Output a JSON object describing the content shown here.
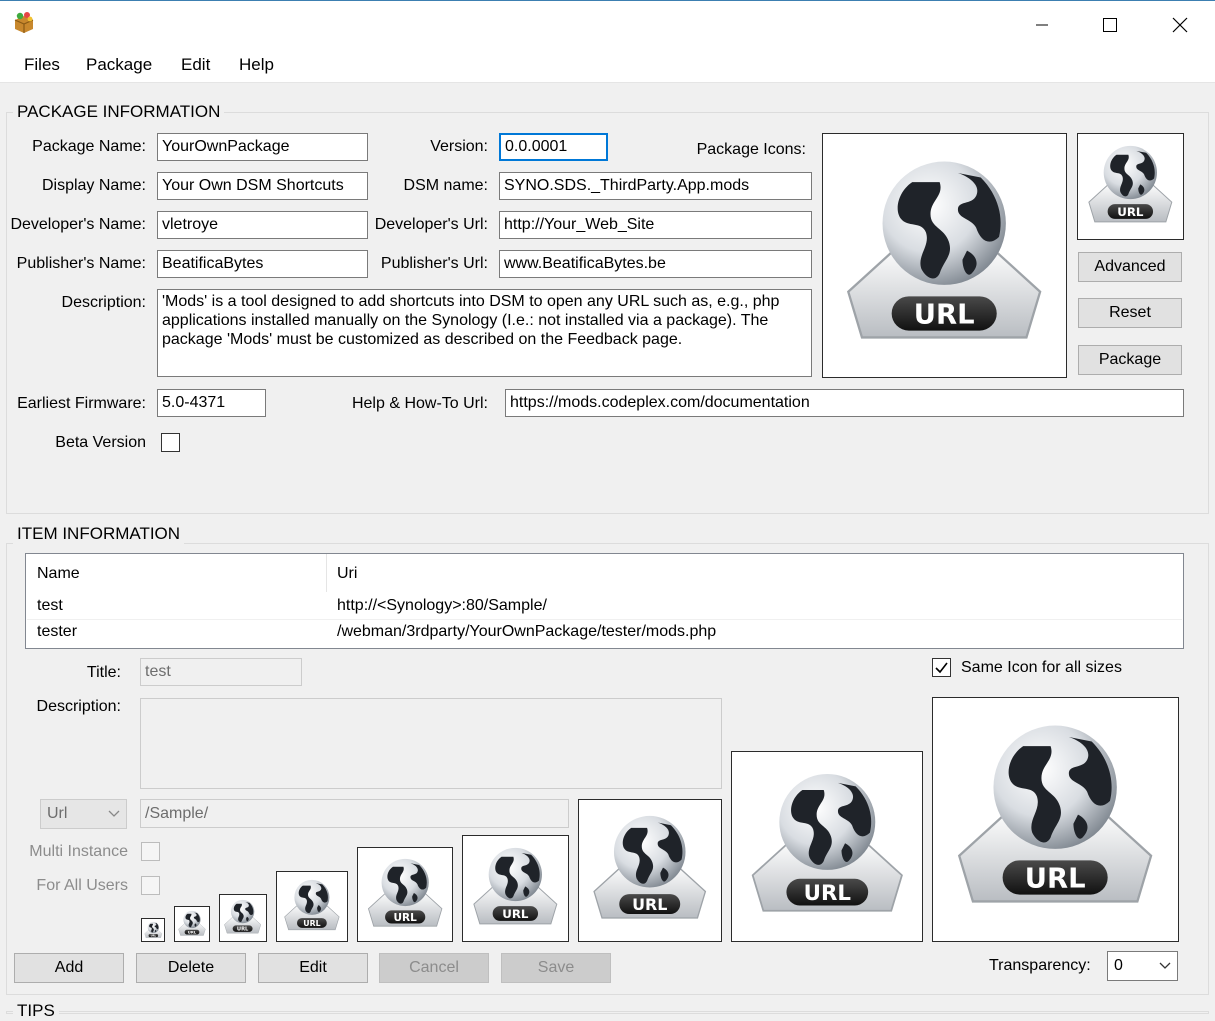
{
  "menu": [
    "Files",
    "Package",
    "Edit",
    "Help"
  ],
  "package_info": {
    "section_title": "PACKAGE INFORMATION",
    "package_name_label": "Package Name:",
    "package_name_value": "YourOwnPackage",
    "version_label": "Version:",
    "version_value": "0.0.0001",
    "package_icons_label": "Package Icons:",
    "display_name_label": "Display Name:",
    "display_name_value": "Your Own DSM Shortcuts",
    "dsm_name_label": "DSM name:",
    "dsm_name_value": "SYNO.SDS._ThirdParty.App.mods",
    "developer_name_label": "Developer's Name:",
    "developer_name_value": "vletroye",
    "developer_url_label": "Developer's Url:",
    "developer_url_value": "http://Your_Web_Site",
    "publisher_name_label": "Publisher's Name:",
    "publisher_name_value": "BeatificaBytes",
    "publisher_url_label": "Publisher's Url:",
    "publisher_url_value": "www.BeatificaBytes.be",
    "description_label": "Description:",
    "description_value": "'Mods' is a tool designed to add shortcuts into DSM to open any URL such as, e.g., php applications installed manually on the Synology (I.e.: not installed via a package). The package 'Mods' must be customized as described on the Feedback page.",
    "earliest_firmware_label": "Earliest Firmware:",
    "earliest_firmware_value": "5.0-4371",
    "help_url_label": "Help & How-To Url:",
    "help_url_value": "https://mods.codeplex.com/documentation",
    "beta_label": "Beta Version",
    "beta_checked": false,
    "advanced_button": "Advanced",
    "reset_button": "Reset",
    "package_button": "Package",
    "icon_text": "URL"
  },
  "item_info": {
    "section_title": "ITEM INFORMATION",
    "columns": [
      "Name",
      "Uri"
    ],
    "rows": [
      {
        "name": "test",
        "uri": "http://<Synology>:80/Sample/"
      },
      {
        "name": "tester",
        "uri": "/webman/3rdparty/YourOwnPackage/tester/mods.php"
      }
    ],
    "title_label": "Title:",
    "title_value": "test",
    "description_label": "Description:",
    "description_value": "",
    "type_select_value": "Url",
    "url_value": "/Sample/",
    "multi_instance_label": "Multi Instance",
    "for_all_users_label": "For All Users",
    "same_icon_label": "Same Icon for all sizes",
    "same_icon_checked": true,
    "transparency_label": "Transparency:",
    "transparency_value": "0",
    "add_button": "Add",
    "delete_button": "Delete",
    "edit_button": "Edit",
    "cancel_button": "Cancel",
    "save_button": "Save"
  },
  "tips": {
    "section_title": "TIPS"
  },
  "colors": {
    "window_bg": "#f0f0f0",
    "focus_border": "#0078d7",
    "title_border": "#3c7fb1"
  },
  "icons": [
    "package-box-icon",
    "minimize-icon",
    "maximize-icon",
    "close-icon",
    "globe-url-icon",
    "chevron-down-icon",
    "check-icon"
  ]
}
